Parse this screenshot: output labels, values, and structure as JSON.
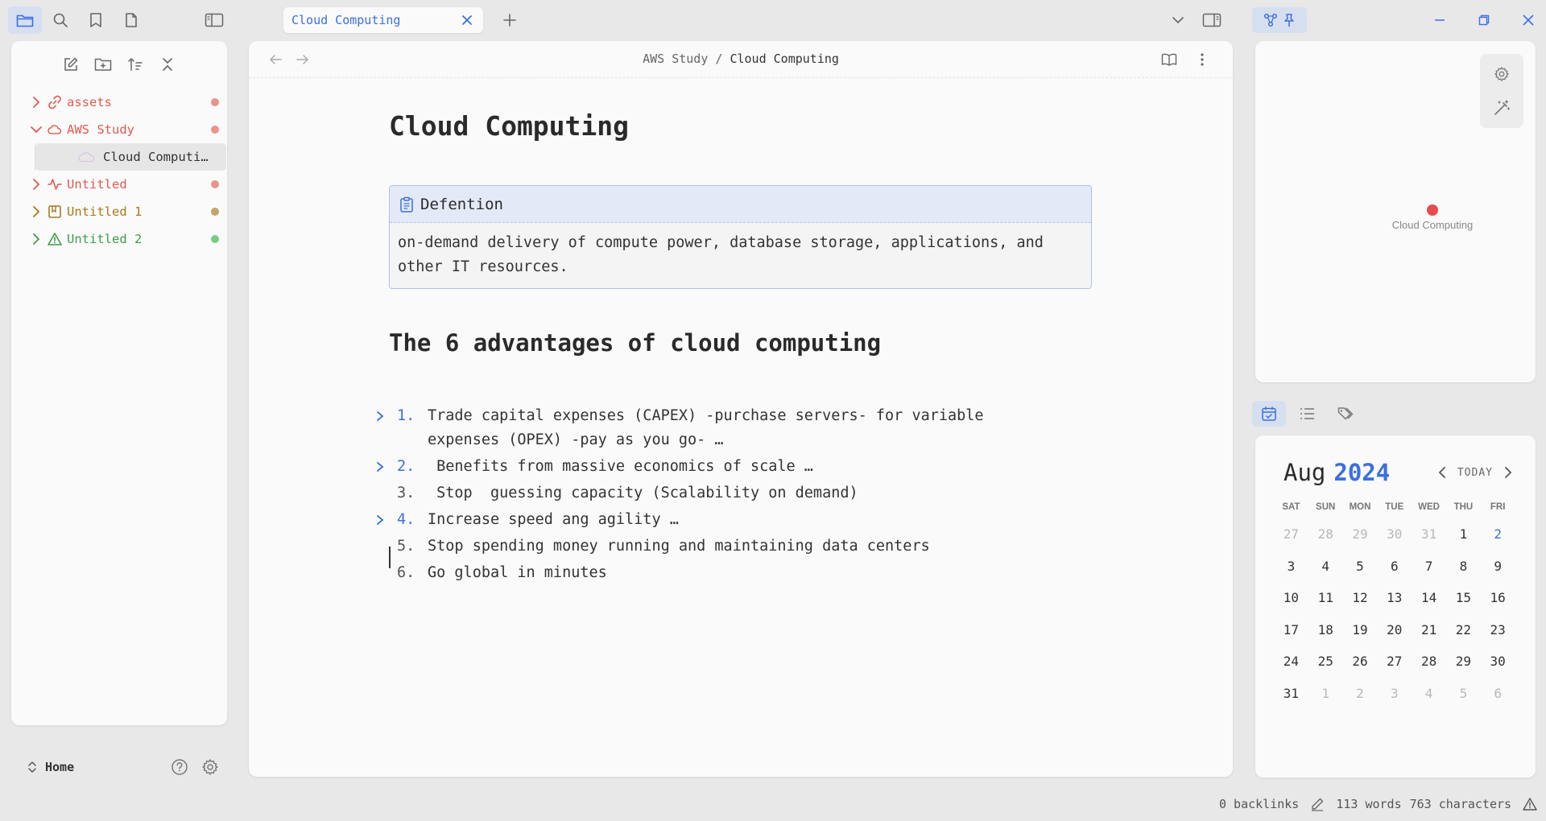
{
  "topbar": {
    "left_icons": [
      "folder-icon",
      "search-icon",
      "bookmark-icon",
      "file-icon"
    ],
    "sidebar_toggle_icon": "sidebar-left-icon",
    "tab": {
      "title": "Cloud Computing",
      "close_icon": "close-icon"
    },
    "new_tab_icon": "plus-icon",
    "tab_list_icon": "chevron-down-icon",
    "right_sidebar_icon": "sidebar-right-icon",
    "right_icons": [
      "graph-icon",
      "pin-icon"
    ],
    "window_controls": [
      "minimize-icon",
      "restore-icon",
      "close-icon"
    ]
  },
  "sidebar": {
    "actions": [
      "new-note-icon",
      "new-folder-icon",
      "sort-icon",
      "collapse-all-icon"
    ],
    "items": [
      {
        "label": "assets",
        "color": "#e05a4f",
        "dot": "#e8948c",
        "expanded": false,
        "icon": "link-icon"
      },
      {
        "label": "AWS Study",
        "color": "#e05a4f",
        "dot": "#e8948c",
        "expanded": true,
        "icon": "cloud-icon"
      },
      {
        "label": "Cloud Computing",
        "color": "#333333",
        "child": true,
        "icon": "cloud-outline-icon"
      },
      {
        "label": "Untitled",
        "color": "#e05a4f",
        "dot": "#e8948c",
        "expanded": false,
        "icon": "activity-icon"
      },
      {
        "label": "Untitled 1",
        "color": "#a87a1e",
        "dot": "#c4a46a",
        "expanded": false,
        "icon": "bookmark-square-icon"
      },
      {
        "label": "Untitled 2",
        "color": "#3e9e4a",
        "dot": "#7ccb84",
        "expanded": false,
        "icon": "warning-icon"
      }
    ],
    "vault_name": "Home",
    "help_icon": "help-icon",
    "settings_icon": "gear-icon"
  },
  "editor": {
    "breadcrumb": {
      "parent": "AWS Study",
      "separator": "/",
      "current": "Cloud Computing"
    },
    "title": "Cloud Computing",
    "callout": {
      "title": "Defention",
      "body": "on-demand delivery of compute power, database storage, applications, and other IT resources."
    },
    "advantages_heading": "The 6 advantages of cloud computing",
    "advantages": [
      {
        "num": "1.",
        "text": "Trade capital expenses (CAPEX) -purchase servers- for variable\nexpenses (OPEX) -pay as you go- …",
        "foldable": true
      },
      {
        "num": "2.",
        "text": " Benefits from massive economics of scale …",
        "foldable": true
      },
      {
        "num": "3.",
        "text": " Stop  guessing capacity (Scalability on demand)",
        "foldable": false
      },
      {
        "num": "4.",
        "text": "Increase speed ang agility …",
        "foldable": true
      },
      {
        "num": "5.",
        "text": "Stop spending money running and maintaining data centers",
        "foldable": false
      },
      {
        "num": "6.",
        "text": "Go global in minutes",
        "foldable": false
      }
    ]
  },
  "graph": {
    "node_label": "Cloud Computing",
    "node_color": "#e84b4b",
    "controls": [
      "gear-icon",
      "magic-wand-icon"
    ]
  },
  "right_tabs": [
    "calendar-icon",
    "list-icon",
    "tags-icon"
  ],
  "calendar": {
    "month": "Aug",
    "year": "2024",
    "today_label": "TODAY",
    "weekdays": [
      "SAT",
      "SUN",
      "MON",
      "TUE",
      "WED",
      "THU",
      "FRI"
    ],
    "weeks": [
      [
        {
          "d": "27",
          "m": true
        },
        {
          "d": "28",
          "m": true
        },
        {
          "d": "29",
          "m": true
        },
        {
          "d": "30",
          "m": true
        },
        {
          "d": "31",
          "m": true
        },
        {
          "d": "1"
        },
        {
          "d": "2",
          "t": true
        }
      ],
      [
        {
          "d": "3"
        },
        {
          "d": "4"
        },
        {
          "d": "5"
        },
        {
          "d": "6"
        },
        {
          "d": "7"
        },
        {
          "d": "8"
        },
        {
          "d": "9"
        }
      ],
      [
        {
          "d": "10"
        },
        {
          "d": "11"
        },
        {
          "d": "12"
        },
        {
          "d": "13"
        },
        {
          "d": "14"
        },
        {
          "d": "15"
        },
        {
          "d": "16"
        }
      ],
      [
        {
          "d": "17"
        },
        {
          "d": "18"
        },
        {
          "d": "19"
        },
        {
          "d": "20"
        },
        {
          "d": "21"
        },
        {
          "d": "22"
        },
        {
          "d": "23"
        }
      ],
      [
        {
          "d": "24"
        },
        {
          "d": "25"
        },
        {
          "d": "26"
        },
        {
          "d": "27"
        },
        {
          "d": "28"
        },
        {
          "d": "29"
        },
        {
          "d": "30"
        }
      ],
      [
        {
          "d": "31"
        },
        {
          "d": "1",
          "m": true
        },
        {
          "d": "2",
          "m": true
        },
        {
          "d": "3",
          "m": true
        },
        {
          "d": "4",
          "m": true
        },
        {
          "d": "5",
          "m": true
        },
        {
          "d": "6",
          "m": true
        }
      ]
    ]
  },
  "status": {
    "backlinks": "0 backlinks",
    "words": "113 words",
    "characters": "763 characters"
  },
  "colors": {
    "accent": "#3b6fe0",
    "panel": "#fafafa",
    "background": "#e8e8e8"
  }
}
